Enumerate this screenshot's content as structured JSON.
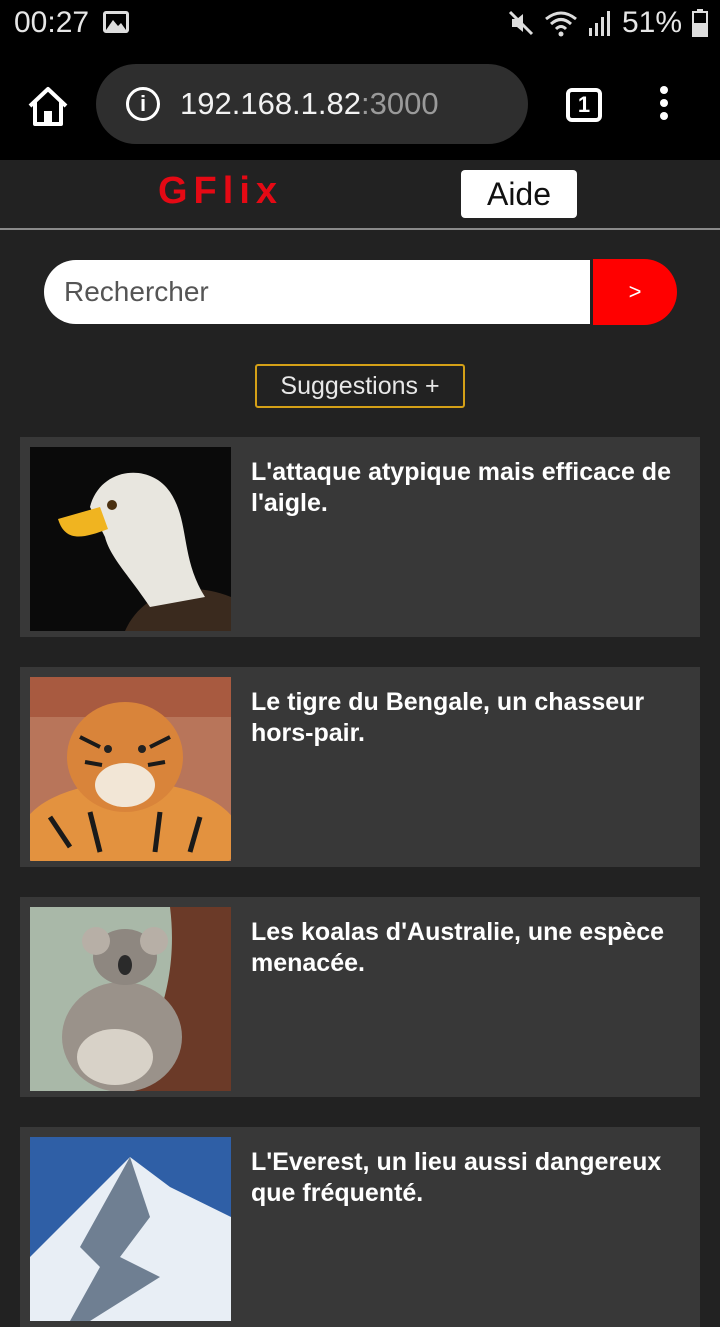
{
  "status": {
    "time": "00:27",
    "battery": "51%"
  },
  "browser": {
    "url_host": "192.168.1.82",
    "url_port": ":3000",
    "tab_count": "1"
  },
  "header": {
    "logo": "GFlix",
    "help_label": "Aide"
  },
  "search": {
    "placeholder": "Rechercher",
    "button_label": ">"
  },
  "suggestions_label": "Suggestions +",
  "articles": [
    {
      "title": "L'attaque atypique mais efficace de l'aigle.",
      "image": "eagle"
    },
    {
      "title": "Le tigre du Bengale, un chasseur hors-pair.",
      "image": "tiger"
    },
    {
      "title": "Les koalas d'Australie, une espèce menacée.",
      "image": "koala"
    },
    {
      "title": "L'Everest, un lieu aussi dangereux que fréquenté.",
      "image": "mountain"
    }
  ]
}
